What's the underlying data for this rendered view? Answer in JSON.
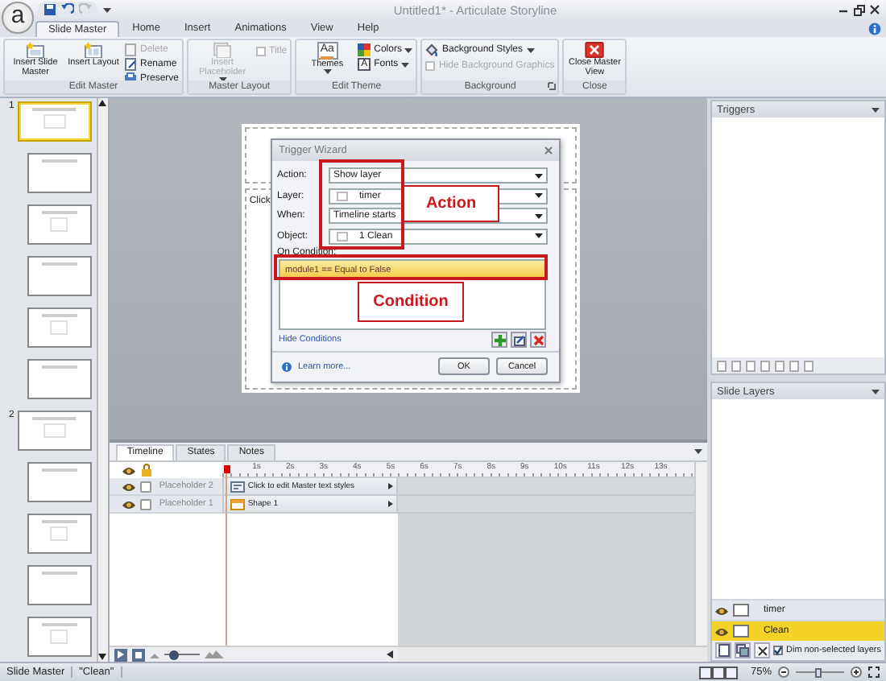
{
  "window": {
    "logo": "a",
    "title": "Untitled1* - Articulate Storyline"
  },
  "ribbon": {
    "tabs": [
      {
        "label": "Slide Master",
        "selected": true
      },
      {
        "label": "Home",
        "selected": false
      },
      {
        "label": "Insert",
        "selected": false
      },
      {
        "label": "Animations",
        "selected": false
      },
      {
        "label": "View",
        "selected": false
      },
      {
        "label": "Help",
        "selected": false
      }
    ],
    "groups": [
      {
        "label": "Edit Master",
        "items": [
          {
            "kind": "large",
            "label": "Insert Slide Master",
            "disabled": false,
            "dropdown": false
          },
          {
            "kind": "large",
            "label": "Insert Layout",
            "disabled": false,
            "dropdown": false
          },
          {
            "kind": "small",
            "label": "Delete",
            "disabled": true,
            "dropdown": false
          },
          {
            "kind": "small",
            "label": "Rename",
            "disabled": false,
            "dropdown": false
          },
          {
            "kind": "small",
            "label": "Preserve",
            "disabled": false,
            "dropdown": false
          }
        ]
      },
      {
        "label": "Master Layout",
        "items": [
          {
            "kind": "large",
            "label": "Insert Placeholder",
            "disabled": true,
            "dropdown": true
          },
          {
            "kind": "check",
            "label": "Title",
            "disabled": true,
            "checked": false
          }
        ]
      },
      {
        "label": "Edit Theme",
        "items": [
          {
            "kind": "large",
            "label": "Themes",
            "icon_text": "Aa",
            "disabled": false,
            "dropdown": true
          },
          {
            "kind": "small",
            "label": "Colors",
            "disabled": false,
            "dropdown": true
          },
          {
            "kind": "small",
            "label": "Fonts",
            "icon_text": "A",
            "disabled": false,
            "dropdown": true
          }
        ]
      },
      {
        "label": "Background",
        "items": [
          {
            "kind": "small",
            "label": "Background Styles",
            "disabled": false,
            "dropdown": true
          },
          {
            "kind": "check",
            "label": "Hide Background Graphics",
            "disabled": true,
            "checked": false
          }
        ]
      },
      {
        "label": "Close",
        "items": [
          {
            "kind": "large",
            "label": "Close Master View",
            "disabled": false,
            "dropdown": false
          }
        ]
      }
    ]
  },
  "thumbnails": [
    {
      "number": "1",
      "slides": [
        {
          "selected": true
        },
        {
          "selected": false
        },
        {
          "selected": false
        },
        {
          "selected": false
        },
        {
          "selected": false
        },
        {
          "selected": false
        }
      ]
    },
    {
      "number": "2",
      "slides": [
        {
          "selected": false
        },
        {
          "selected": false
        },
        {
          "selected": false
        },
        {
          "selected": false
        },
        {
          "selected": false
        }
      ]
    }
  ],
  "stage": {
    "placeholder_text": "Click"
  },
  "dialog": {
    "title": "Trigger Wizard",
    "fields": [
      {
        "label": "Action:",
        "value": "Show layer",
        "kind": "plain"
      },
      {
        "label": "Layer:",
        "value": "timer",
        "kind": "swatch"
      },
      {
        "label": "When:",
        "value": "Timeline starts",
        "kind": "plain"
      },
      {
        "label": "Object:",
        "value": "1 Clean",
        "kind": "swatch"
      }
    ],
    "conditions_label": "On Condition:",
    "conditions": [
      {
        "text": "module1 == Equal to False",
        "selected": true
      }
    ],
    "hide_link": "Hide Conditions",
    "learn_link": "Learn more...",
    "buttons": [
      "OK",
      "Cancel"
    ]
  },
  "annotations": [
    {
      "label": "Action"
    },
    {
      "label": "Condition"
    }
  ],
  "timeline": {
    "tabs": [
      {
        "label": "Timeline",
        "selected": true
      },
      {
        "label": "States",
        "selected": false
      },
      {
        "label": "Notes",
        "selected": false
      }
    ],
    "ruler": [
      "1s",
      "2s",
      "3s",
      "4s",
      "5s",
      "6s",
      "7s",
      "8s",
      "9s",
      "10s",
      "11s",
      "12s",
      "13s"
    ],
    "rows": [
      {
        "name": "Placeholder 2",
        "object": "Click to edit Master text styles",
        "kind": "text",
        "locked": false
      },
      {
        "name": "Placeholder 1",
        "object": "Shape 1",
        "kind": "shape",
        "locked": false
      }
    ],
    "zoom_slider": {
      "level": 0.3
    }
  },
  "triggers": {
    "title": "Triggers"
  },
  "layers": {
    "title": "Slide Layers",
    "items": [
      {
        "name": "timer",
        "selected": false
      },
      {
        "name": "Clean",
        "selected": true
      }
    ],
    "dim_option": {
      "label": "Dim non-selected layers",
      "checked": true
    }
  },
  "status_bar": {
    "items": [
      "Slide Master",
      "\"Clean\""
    ],
    "zoom": "75%",
    "zoom_slider": {
      "level": 0.45
    }
  }
}
